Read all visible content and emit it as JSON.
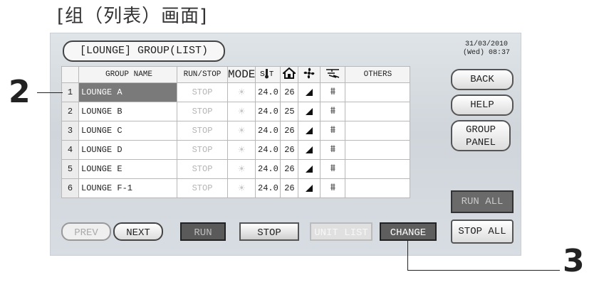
{
  "caption": "[组（列表）画面]",
  "screen": {
    "title": "[LOUNGE] GROUP(LIST)",
    "date": "31/03/2010",
    "time": "(Wed) 08:37",
    "headers": {
      "name": "GROUP NAME",
      "runstop": "RUN/STOP",
      "mode": "MODE",
      "temp_icon": "set-temp-icon",
      "room_icon": "house-icon",
      "fan_icon": "fan-icon",
      "vane_icon": "louver-icon",
      "others": "OTHERS"
    },
    "rows": [
      {
        "num": "1",
        "name": "LOUNGE A",
        "run": "STOP",
        "mode": "☀",
        "temp": "24.0",
        "room": "26",
        "selected": true
      },
      {
        "num": "2",
        "name": "LOUNGE B",
        "run": "STOP",
        "mode": "☀",
        "temp": "24.0",
        "room": "25",
        "selected": false
      },
      {
        "num": "3",
        "name": "LOUNGE C",
        "run": "STOP",
        "mode": "☀",
        "temp": "24.0",
        "room": "26",
        "selected": false
      },
      {
        "num": "4",
        "name": "LOUNGE D",
        "run": "STOP",
        "mode": "☀",
        "temp": "24.0",
        "room": "26",
        "selected": false
      },
      {
        "num": "5",
        "name": "LOUNGE E",
        "run": "STOP",
        "mode": "☀",
        "temp": "24.0",
        "room": "26",
        "selected": false
      },
      {
        "num": "6",
        "name": "LOUNGE F-1",
        "run": "STOP",
        "mode": "☀",
        "temp": "24.0",
        "room": "26",
        "selected": false
      }
    ],
    "buttons": {
      "back": "BACK",
      "help": "HELP",
      "group_panel_1": "GROUP",
      "group_panel_2": "PANEL",
      "run_all": "RUN ALL",
      "stop_all": "STOP ALL",
      "prev": "PREV",
      "next": "NEXT",
      "run": "RUN",
      "stop": "STOP",
      "unit_list": "UNIT LIST",
      "change": "CHANGE"
    }
  },
  "callouts": {
    "two": "2",
    "three": "3"
  }
}
